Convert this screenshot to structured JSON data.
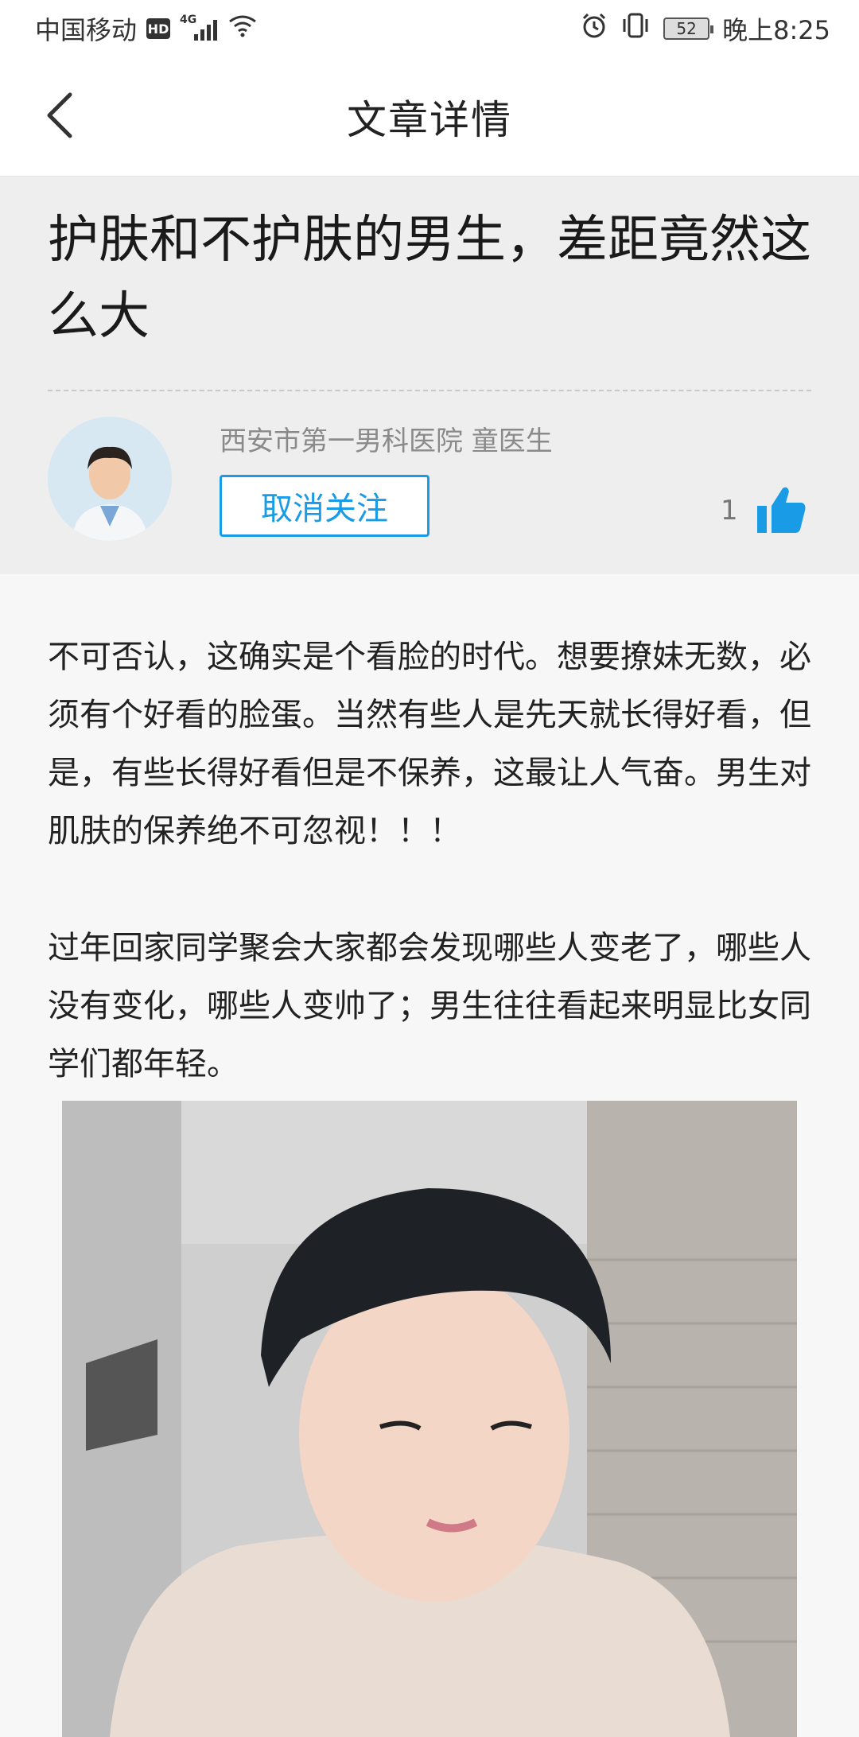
{
  "status_bar": {
    "carrier": "中国移动",
    "hd": "HD",
    "network": "4G",
    "battery": "52",
    "time": "晚上8:25"
  },
  "nav": {
    "title": "文章详情",
    "back_icon": "chevron-left-icon"
  },
  "article": {
    "title": "护肤和不护肤的男生，差距竟然这么大",
    "author": "西安市第一男科医院 童医生",
    "follow_label": "取消关注",
    "like_count": "1",
    "paragraphs": [
      "不可否认，这确实是个看脸的时代。想要撩妹无数，必须有个好看的脸蛋。当然有些人是先天就长得好看，但是，有些长得好看但是不保养，这最让人气奋。男生对肌肤的保养绝不可忽视！！！",
      "过年回家同学聚会大家都会发现哪些人变老了，哪些人没有变化，哪些人变帅了；男生往往看起来明显比女同学们都年轻。"
    ]
  },
  "colors": {
    "accent": "#1a9be6",
    "header_bg": "#eeeeee",
    "body_bg": "#f7f7f7"
  }
}
